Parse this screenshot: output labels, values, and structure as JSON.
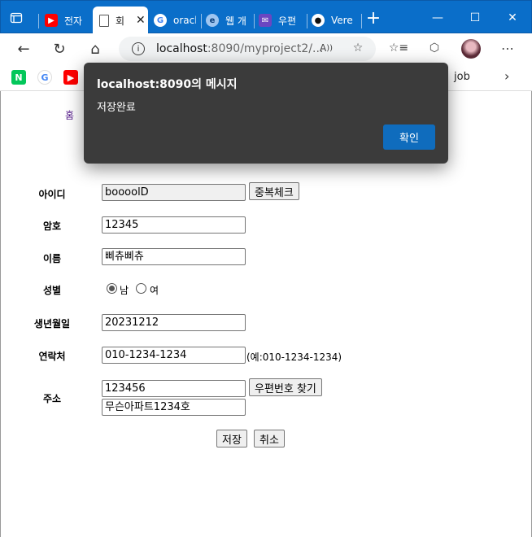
{
  "browser": {
    "tabs": [
      {
        "label": "전자",
        "icon": "youtube-icon"
      },
      {
        "label": "회",
        "icon": "page-icon",
        "active": true
      },
      {
        "label": "oracl",
        "icon": "google-icon"
      },
      {
        "label": "웹 개",
        "icon": "edge-icon"
      },
      {
        "label": "우편",
        "icon": "mail-icon"
      },
      {
        "label": "Vere",
        "icon": "github-icon"
      }
    ],
    "url_host": "localhost",
    "url_rest": ":8090/myproject2/...",
    "bookmarks_folder": "job"
  },
  "page": {
    "home_link": "홈",
    "form": {
      "id_label": "아이디",
      "id_value": "boooolD",
      "dup_check_button": "중복체크",
      "pw_label": "암호",
      "pw_value": "12345",
      "name_label": "이름",
      "name_value": "삐츄삐츄",
      "gender_label": "성별",
      "gender_male": "남",
      "gender_female": "여",
      "gender_selected": "남",
      "birth_label": "생년월일",
      "birth_value": "20231212",
      "phone_label": "연락처",
      "phone_value": "010-1234-1234",
      "phone_hint": "(예:010-1234-1234)",
      "addr_label": "주소",
      "zip_value": "123456",
      "zip_search_button": "우편번호 찾기",
      "addr_detail_value": "무슨아파트1234호",
      "save_button": "저장",
      "cancel_button": "취소"
    }
  },
  "dialog": {
    "title": "localhost:8090의 메시지",
    "message": "저장완료",
    "ok_button": "확인"
  },
  "colors": {
    "tabbar": "#0a6ec9",
    "dialog_bg": "#3b3b3b",
    "primary_button": "#0f6cbd"
  }
}
